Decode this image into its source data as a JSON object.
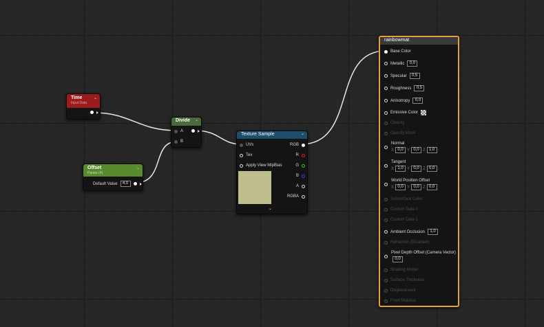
{
  "nodes": {
    "time": {
      "title": "Time",
      "subtitle": "Input Data",
      "header_color": "#9b1c1c"
    },
    "offset": {
      "title": "Offset",
      "subtitle": "Param (4)",
      "header_color": "#5a8a2e",
      "param_label": "Default Value",
      "param_value": "4,0"
    },
    "divide": {
      "title": "Divide",
      "header_color": "#4a6a3a",
      "inputs": [
        "A",
        "B"
      ]
    },
    "texture_sample": {
      "title": "Texture Sample",
      "header_color": "#1f4d6b",
      "inputs": [
        "UVs",
        "Tex",
        "Apply View MipBias"
      ],
      "outputs": [
        "RGB",
        "R",
        "G",
        "B",
        "A",
        "RGBA"
      ],
      "preview_color": "#bfbe8f"
    },
    "material": {
      "title": "rainbowmat",
      "header_color": "#3a3a3a",
      "border_color": "#e2a43a",
      "pins": {
        "base_color": "Base Color",
        "metallic": "Metallic",
        "metallic_value": "0,0",
        "specular": "Specular",
        "specular_value": "0,5",
        "roughness": "Roughness",
        "roughness_value": "0,5",
        "anisotropy": "Anisotropy",
        "anisotropy_value": "0,0",
        "emissive": "Emissive Color",
        "opacity": "Opacity",
        "opacity_mask": "Opacity Mask",
        "normal": "Normal",
        "normal_x": "0,0",
        "normal_y": "0,0",
        "normal_z": "1,0",
        "tangent": "Tangent",
        "tangent_x": "1,0",
        "tangent_y": "0,0",
        "tangent_z": "0,0",
        "wpo": "World Position Offset",
        "wpo_x": "0,0",
        "wpo_y": "0,0",
        "wpo_z": "0,0",
        "subsurface": "Subsurface Color",
        "custom0": "Custom Data 0",
        "custom1": "Custom Data 1",
        "ao": "Ambient Occlusion",
        "ao_value": "1,0",
        "refraction": "Refraction (Disabled)",
        "pdo": "Pixel Depth Offset (Camera Vector)",
        "pdo_value": "0,0",
        "shading_model": "Shading Model",
        "surface_thickness": "Surface Thickness",
        "displacement": "Displacement",
        "front_material": "Front Material"
      },
      "axis_labels": {
        "x": "X",
        "y": "Y",
        "z": "Z"
      }
    }
  }
}
